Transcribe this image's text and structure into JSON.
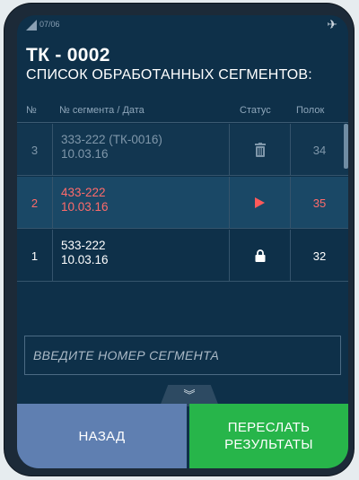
{
  "status_bar": {
    "time": "07/06"
  },
  "header": {
    "title": "ТК - 0002",
    "subtitle": "СПИСОК ОБРАБОТАННЫХ СЕГМЕНТОВ:"
  },
  "table": {
    "columns": [
      "№",
      "№ сегмента / Дата",
      "Статус",
      "Полок"
    ],
    "rows": [
      {
        "no": "3",
        "segment": "333-222 (ТК-0016)",
        "date": "10.03.16",
        "status_icon": "trash-icon",
        "shelves": "34"
      },
      {
        "no": "2",
        "segment": "433-222",
        "date": "10.03.16",
        "status_icon": "play-icon",
        "shelves": "35"
      },
      {
        "no": "1",
        "segment": "533-222",
        "date": "10.03.16",
        "status_icon": "lock-icon",
        "shelves": "32"
      }
    ]
  },
  "search": {
    "placeholder": "ВВЕДИТЕ НОМЕР СЕГМЕНТА"
  },
  "footer": {
    "back_label": "НАЗАД",
    "send_line1": "ПЕРЕСЛАТЬ",
    "send_line2": "РЕЗУЛЬТАТЫ"
  },
  "colors": {
    "background": "#0e3049",
    "active_row": "#ff6b6b",
    "back_button": "#5f7fb1",
    "send_button": "#27b54a"
  }
}
